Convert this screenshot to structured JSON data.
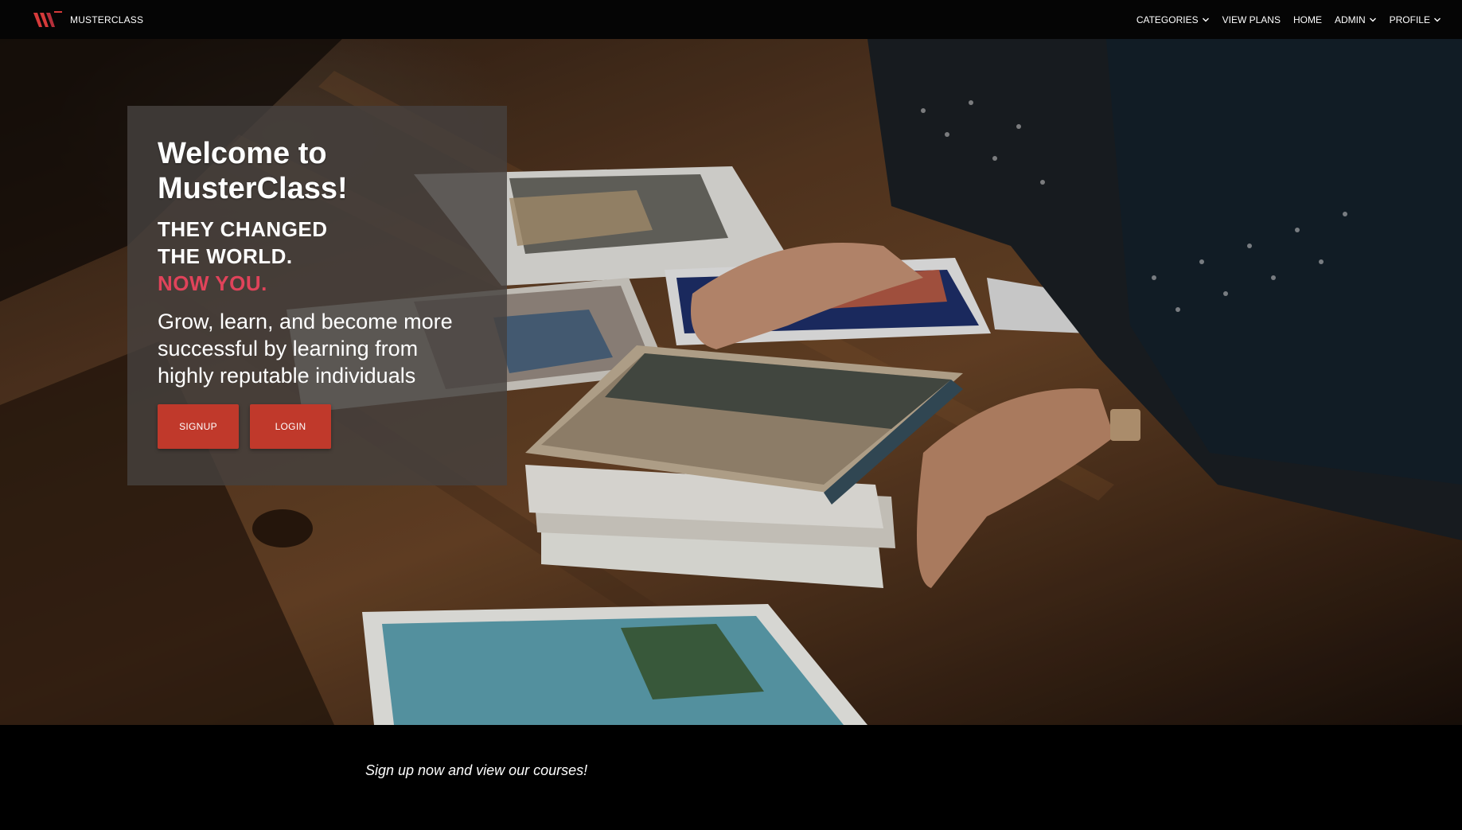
{
  "brand": {
    "name": "MUSTERCLASS",
    "logo_icon": "mc-logo-icon",
    "logo_color": "#d63a3a"
  },
  "nav": {
    "items": [
      {
        "label": "CATEGORIES",
        "dropdown": true
      },
      {
        "label": "VIEW PLANS",
        "dropdown": false
      },
      {
        "label": "HOME",
        "dropdown": false
      },
      {
        "label": "ADMIN",
        "dropdown": true
      },
      {
        "label": "PROFILE",
        "dropdown": true
      }
    ]
  },
  "hero": {
    "title": "Welcome to MusterClass!",
    "tagline_line1": "THEY CHANGED",
    "tagline_line2": "THE WORLD.",
    "tagline_accent": "NOW YOU.",
    "description": "Grow, learn, and become more successful by learning from highly reputable individuals",
    "signup_label": "SIGNUP",
    "login_label": "LOGIN",
    "accent_color": "#e0435a",
    "button_color": "#c0392b"
  },
  "footer": {
    "note": "Sign up now and view our courses!"
  }
}
